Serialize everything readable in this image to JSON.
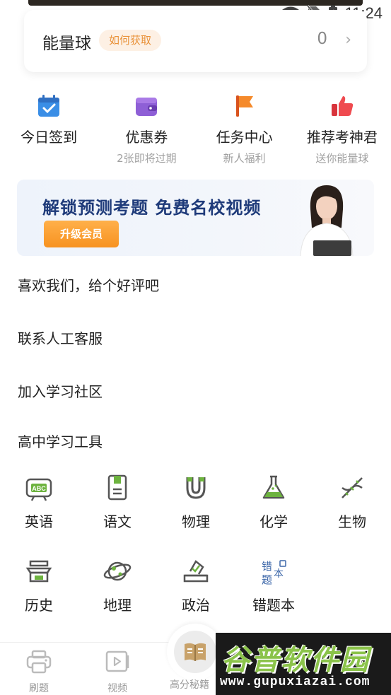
{
  "status_bar": {
    "time": "11:24"
  },
  "energy": {
    "title": "能量球",
    "badge": "如何获取",
    "count": "0"
  },
  "quick_actions": [
    {
      "label": "今日签到",
      "sub": "",
      "icon": "calendar-check-icon"
    },
    {
      "label": "优惠券",
      "sub": "2张即将过期",
      "icon": "wallet-icon"
    },
    {
      "label": "任务中心",
      "sub": "新人福利",
      "icon": "flag-icon"
    },
    {
      "label": "推荐考神君",
      "sub": "送你能量球",
      "icon": "thumbs-up-icon"
    }
  ],
  "banner": {
    "headline": "解锁预测考题  免费名校视频",
    "button": "升级会员"
  },
  "menu": {
    "rate": "喜欢我们，给个好评吧",
    "service": "联系人工客服",
    "community": "加入学习社区",
    "tools_title": "高中学习工具"
  },
  "subjects": [
    {
      "label": "英语",
      "icon": "abc-board-icon"
    },
    {
      "label": "语文",
      "icon": "book-icon"
    },
    {
      "label": "物理",
      "icon": "magnet-icon"
    },
    {
      "label": "化学",
      "icon": "flask-icon"
    },
    {
      "label": "生物",
      "icon": "dna-icon"
    },
    {
      "label": "历史",
      "icon": "temple-icon"
    },
    {
      "label": "地理",
      "icon": "planet-icon"
    },
    {
      "label": "政治",
      "icon": "ballot-icon"
    },
    {
      "label": "错题本",
      "icon": "wrong-notebook-icon"
    }
  ],
  "wrong_notebook_icon_text": "错题本",
  "bottom_nav": [
    {
      "label": "刷题",
      "icon": "printer-icon"
    },
    {
      "label": "视频",
      "icon": "video-icon"
    },
    {
      "label": "高分秘籍",
      "icon": "open-book-icon"
    }
  ],
  "watermark": {
    "title": "谷普软件园",
    "url": "www.gupuxiazai.com"
  },
  "colors": {
    "accent_orange": "#f79220",
    "badge_text": "#e9923a",
    "subject_green": "#6db33f",
    "banner_text": "#1f3b7a"
  }
}
